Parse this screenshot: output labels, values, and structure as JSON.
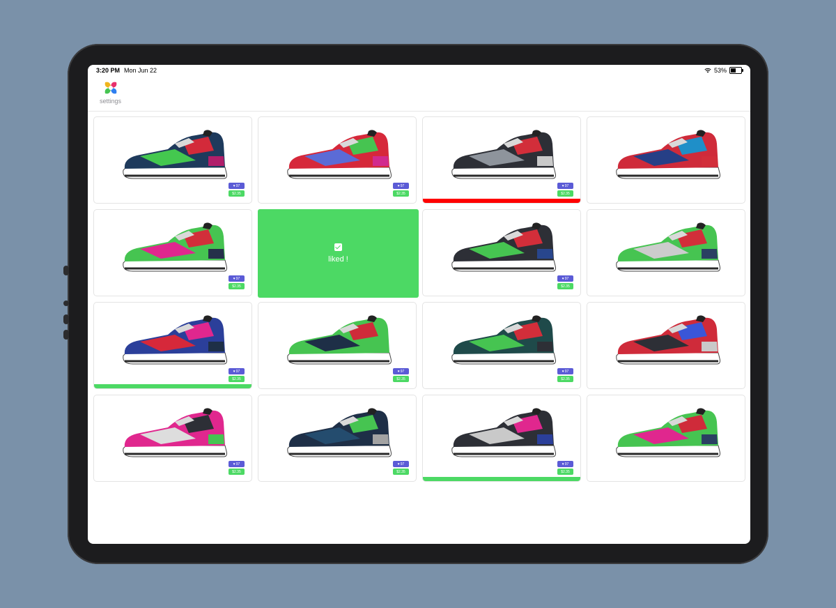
{
  "status_bar": {
    "time": "3:20 PM",
    "date": "Mon Jun 22",
    "battery": "53%",
    "battery_level": 0.53
  },
  "header": {
    "settings_label": "settings"
  },
  "liked_overlay": {
    "label": "liked !"
  },
  "colors": {
    "liked": "#4cd964",
    "disliked": "#ff0000",
    "likes_badge": "#5b5bd6",
    "price_badge": "#4cd964"
  },
  "products": [
    {
      "likes": "97",
      "price": "$2.35",
      "status": "none",
      "colors": [
        "#1e3a5c",
        "#44c84f",
        "#d32a3a",
        "#b01e6a"
      ]
    },
    {
      "likes": "97",
      "price": "$2.35",
      "status": "none",
      "colors": [
        "#d6283a",
        "#5b6bd6",
        "#46c451",
        "#d12a8e"
      ]
    },
    {
      "likes": "97",
      "price": "$2.35",
      "status": "disliked",
      "colors": [
        "#2d2f36",
        "#8e949c",
        "#d22e3a",
        "#c9c9c9"
      ]
    },
    {
      "likes": "",
      "price": "",
      "status": "none",
      "colors": [
        "#cf2b3a",
        "#263f86",
        "#1f8fc8",
        "#d22e3a"
      ]
    },
    {
      "likes": "97",
      "price": "$2.35",
      "status": "none",
      "colors": [
        "#46c451",
        "#e0278e",
        "#d22e3a",
        "#25304a"
      ]
    },
    {
      "likes": "",
      "price": "",
      "status": "liked_overlay",
      "colors": []
    },
    {
      "likes": "97",
      "price": "$2.35",
      "status": "none",
      "colors": [
        "#2d2f36",
        "#46c451",
        "#d22e3a",
        "#28468d"
      ]
    },
    {
      "likes": "",
      "price": "",
      "status": "none",
      "colors": [
        "#46c451",
        "#cccccc",
        "#d22e3a",
        "#2a4062"
      ]
    },
    {
      "likes": "97",
      "price": "$2.35",
      "status": "liked",
      "colors": [
        "#2b3f9a",
        "#d6283a",
        "#e0278e",
        "#1e2f47"
      ]
    },
    {
      "likes": "97",
      "price": "$2.35",
      "status": "none",
      "colors": [
        "#46c451",
        "#1e2f47",
        "#cf2b3a",
        "#46c451"
      ]
    },
    {
      "likes": "97",
      "price": "$2.35",
      "status": "none",
      "colors": [
        "#1f4a4a",
        "#46c451",
        "#d22e3a",
        "#2d2f36"
      ]
    },
    {
      "likes": "",
      "price": "",
      "status": "none",
      "colors": [
        "#cf2b3a",
        "#2d2f36",
        "#3a56d8",
        "#c9c9c9"
      ]
    },
    {
      "likes": "97",
      "price": "$2.35",
      "status": "none",
      "colors": [
        "#e0278e",
        "#dddddd",
        "#2d2f36",
        "#46c451"
      ]
    },
    {
      "likes": "97",
      "price": "$2.35",
      "status": "none",
      "colors": [
        "#1e2f47",
        "#244c6e",
        "#46c451",
        "#a3a3a3"
      ]
    },
    {
      "likes": "97",
      "price": "$2.35",
      "status": "liked",
      "colors": [
        "#2d2f36",
        "#c9c9c9",
        "#e0278e",
        "#2b3f9a"
      ]
    },
    {
      "likes": "",
      "price": "",
      "status": "none",
      "colors": [
        "#46c451",
        "#e0278e",
        "#cf2b3a",
        "#2a4062"
      ]
    }
  ]
}
